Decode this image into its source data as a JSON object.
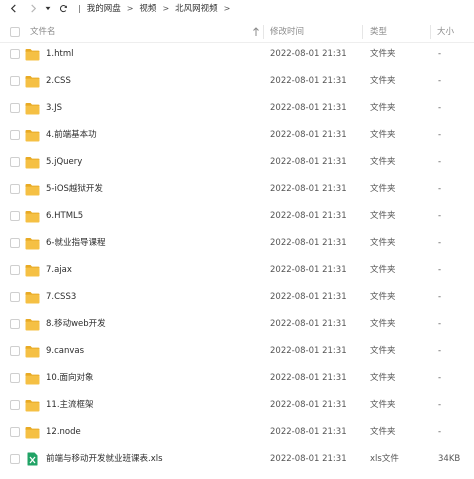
{
  "breadcrumb": [
    "我的网盘",
    "视频",
    "北风网视频"
  ],
  "columns": {
    "name": "文件名",
    "date": "修改时间",
    "type": "类型",
    "size": "大小"
  },
  "files": [
    {
      "name": "1.html",
      "date": "2022-08-01 21:31",
      "type": "文件夹",
      "size": "-",
      "icon": "folder-icon"
    },
    {
      "name": "2.CSS",
      "date": "2022-08-01 21:31",
      "type": "文件夹",
      "size": "-",
      "icon": "folder-icon"
    },
    {
      "name": "3.JS",
      "date": "2022-08-01 21:31",
      "type": "文件夹",
      "size": "-",
      "icon": "folder-icon"
    },
    {
      "name": "4.前端基本功",
      "date": "2022-08-01 21:31",
      "type": "文件夹",
      "size": "-",
      "icon": "folder-icon"
    },
    {
      "name": "5.jQuery",
      "date": "2022-08-01 21:31",
      "type": "文件夹",
      "size": "-",
      "icon": "folder-icon"
    },
    {
      "name": "5-iOS越狱开发",
      "date": "2022-08-01 21:31",
      "type": "文件夹",
      "size": "-",
      "icon": "folder-icon"
    },
    {
      "name": "6.HTML5",
      "date": "2022-08-01 21:31",
      "type": "文件夹",
      "size": "-",
      "icon": "folder-icon"
    },
    {
      "name": "6-就业指导课程",
      "date": "2022-08-01 21:31",
      "type": "文件夹",
      "size": "-",
      "icon": "folder-icon"
    },
    {
      "name": "7.ajax",
      "date": "2022-08-01 21:31",
      "type": "文件夹",
      "size": "-",
      "icon": "folder-icon"
    },
    {
      "name": "7.CSS3",
      "date": "2022-08-01 21:31",
      "type": "文件夹",
      "size": "-",
      "icon": "folder-icon"
    },
    {
      "name": "8.移动web开发",
      "date": "2022-08-01 21:31",
      "type": "文件夹",
      "size": "-",
      "icon": "folder-icon"
    },
    {
      "name": "9.canvas",
      "date": "2022-08-01 21:31",
      "type": "文件夹",
      "size": "-",
      "icon": "folder-icon"
    },
    {
      "name": "10.面向对象",
      "date": "2022-08-01 21:31",
      "type": "文件夹",
      "size": "-",
      "icon": "folder-icon"
    },
    {
      "name": "11.主流框架",
      "date": "2022-08-01 21:31",
      "type": "文件夹",
      "size": "-",
      "icon": "folder-icon"
    },
    {
      "name": "12.node",
      "date": "2022-08-01 21:31",
      "type": "文件夹",
      "size": "-",
      "icon": "folder-icon"
    },
    {
      "name": "前端与移动开发就业班课表.xls",
      "date": "2022-08-01 21:31",
      "type": "xls文件",
      "size": "34KB",
      "icon": "xls-file-icon"
    }
  ],
  "colors": {
    "folder": "#f5c044",
    "folder_tab": "#e8aa24",
    "xls": "#21a366"
  }
}
